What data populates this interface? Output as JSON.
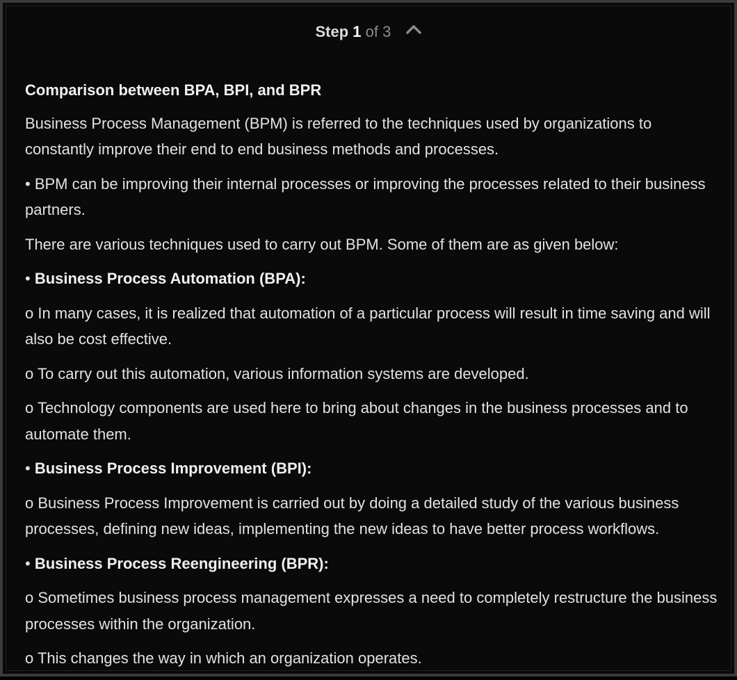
{
  "step": {
    "label": "Step",
    "number": "1",
    "of_text": "of 3",
    "toggle_icon": "chevron-up-icon"
  },
  "content": {
    "title": "Comparison between BPA, BPI, and BPR",
    "intro": "Business Process Management (BPM) is referred to the techniques used by organizations to constantly improve their end to end business methods and processes.",
    "bullet_bpm": "• BPM can be improving their internal processes or improving the processes related to their business partners.",
    "techniques_intro": "There are various techniques used to carry out BPM. Some of them are as given below:",
    "bpa": {
      "bullet": "• ",
      "heading": "Business Process Automation (BPA):",
      "points": [
        "o In many cases, it is realized that automation of a particular process will result in time saving and will also be cost effective.",
        "o To carry out this automation, various information systems are developed.",
        "o Technology components are used here to bring about changes in the business processes and to automate them."
      ]
    },
    "bpi": {
      "bullet": "• ",
      "heading": "Business Process Improvement (BPI):",
      "points": [
        "o Business Process Improvement is carried out by doing a detailed study of the various business processes, defining new ideas, implementing the new ideas to have better process workflows."
      ]
    },
    "bpr": {
      "bullet": "• ",
      "heading": "Business Process Reengineering (BPR):",
      "points": [
        "o Sometimes business process management expresses a need to completely restructure the business processes within the organization.",
        "o This changes the way in which an organization operates."
      ]
    }
  }
}
